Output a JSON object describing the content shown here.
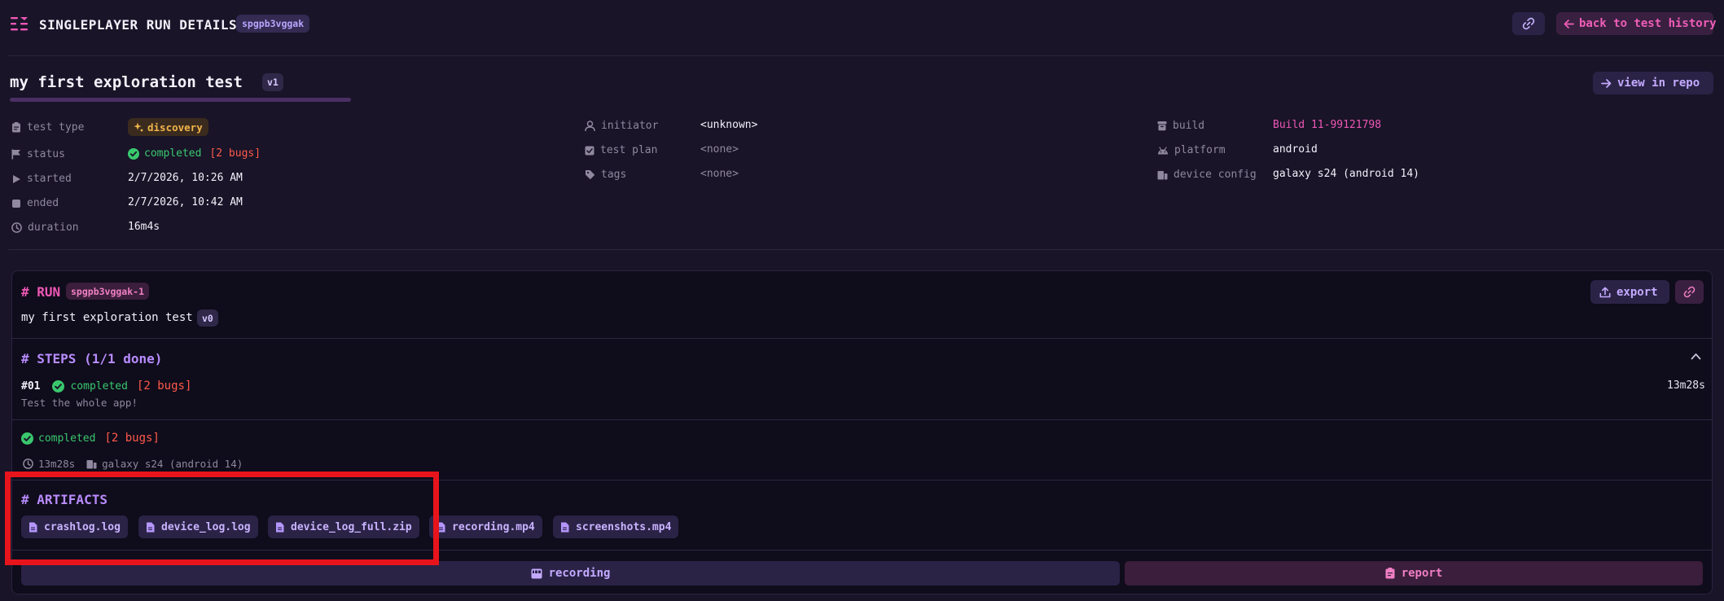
{
  "header": {
    "title": "SINGLEPLAYER RUN DETAILS",
    "run_id": "spgpb3vggak",
    "back_label": "back to test history"
  },
  "test": {
    "name": "my first exploration test",
    "version": "v1",
    "view_repo_label": "view in repo"
  },
  "meta": {
    "test_type_label": "test type",
    "test_type_value": "discovery",
    "status_label": "status",
    "status_value": "completed",
    "status_bugs": "[2 bugs]",
    "started_label": "started",
    "started_value": "2/7/2026, 10:26 AM",
    "ended_label": "ended",
    "ended_value": "2/7/2026, 10:42 AM",
    "duration_label": "duration",
    "duration_value": "16m4s",
    "initiator_label": "initiator",
    "initiator_value": "<unknown>",
    "test_plan_label": "test plan",
    "test_plan_value": "<none>",
    "tags_label": "tags",
    "tags_value": "<none>",
    "build_label": "build",
    "build_value": "Build 11-99121798",
    "platform_label": "platform",
    "platform_value": "android",
    "device_config_label": "device config",
    "device_config_value": "galaxy s24 (android 14)"
  },
  "run": {
    "heading": "# RUN",
    "run_badge": "spgpb3vggak-1",
    "test_name": "my first exploration test",
    "version": "v0",
    "export_label": "export"
  },
  "steps": {
    "heading": "# STEPS (1/1 done)",
    "items": [
      {
        "number": "#01",
        "status": "completed",
        "bugs": "[2 bugs]",
        "duration": "13m28s",
        "description": "Test the whole app!"
      }
    ]
  },
  "summary": {
    "status": "completed",
    "bugs": "[2 bugs]",
    "duration": "13m28s",
    "device": "galaxy s24 (android 14)"
  },
  "artifacts": {
    "heading": "# ARTIFACTS",
    "files": [
      "crashlog.log",
      "device_log.log",
      "device_log_full.zip",
      "recording.mp4",
      "screenshots.mp4"
    ]
  },
  "footer": {
    "recording_label": "recording",
    "report_label": "report"
  },
  "colors": {
    "background": "#191428",
    "accent_pink": "#ee57b5",
    "accent_purple": "#b88cff",
    "success": "#39c86e",
    "danger": "#ff5a4a",
    "highlight_box": "#e8141c"
  }
}
